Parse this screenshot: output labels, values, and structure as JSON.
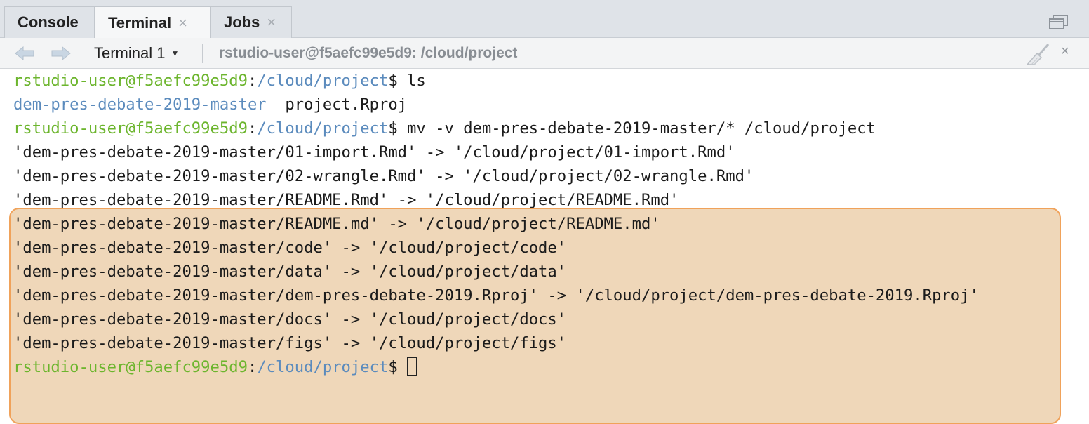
{
  "tabs": [
    {
      "label": "Console",
      "closable": false,
      "active": false
    },
    {
      "label": "Terminal",
      "closable": true,
      "active": true
    },
    {
      "label": "Jobs",
      "closable": true,
      "active": false
    }
  ],
  "toolbar": {
    "terminal_selector": "Terminal 1",
    "session_title": "rstudio-user@f5aefc99e5d9: /cloud/project",
    "close_glyph": "×"
  },
  "terminal": {
    "prompt_user": "rstudio-user@f5aefc99e5d9",
    "prompt_sep": ":",
    "prompt_path": "/cloud/project",
    "prompt_symbol": "$",
    "commands": [
      "ls",
      "mv -v dem-pres-debate-2019-master/* /cloud/project",
      ""
    ],
    "ls_output": {
      "dir": "dem-pres-debate-2019-master",
      "file": "project.Rproj"
    },
    "mv_output": [
      "'dem-pres-debate-2019-master/01-import.Rmd' -> '/cloud/project/01-import.Rmd'",
      "'dem-pres-debate-2019-master/02-wrangle.Rmd' -> '/cloud/project/02-wrangle.Rmd'",
      "'dem-pres-debate-2019-master/README.Rmd' -> '/cloud/project/README.Rmd'",
      "'dem-pres-debate-2019-master/README.md' -> '/cloud/project/README.md'",
      "'dem-pres-debate-2019-master/code' -> '/cloud/project/code'",
      "'dem-pres-debate-2019-master/data' -> '/cloud/project/data'",
      "'dem-pres-debate-2019-master/dem-pres-debate-2019.Rproj' -> '/cloud/project/dem-pres-debate-2019.Rproj'",
      "'dem-pres-debate-2019-master/docs' -> '/cloud/project/docs'",
      "'dem-pres-debate-2019-master/figs' -> '/cloud/project/figs'"
    ]
  },
  "colors": {
    "prompt_user": "#6cb52d",
    "prompt_path": "#5b8bbd",
    "highlight_fill": "#efd7b9",
    "highlight_border": "#f0a25a"
  }
}
